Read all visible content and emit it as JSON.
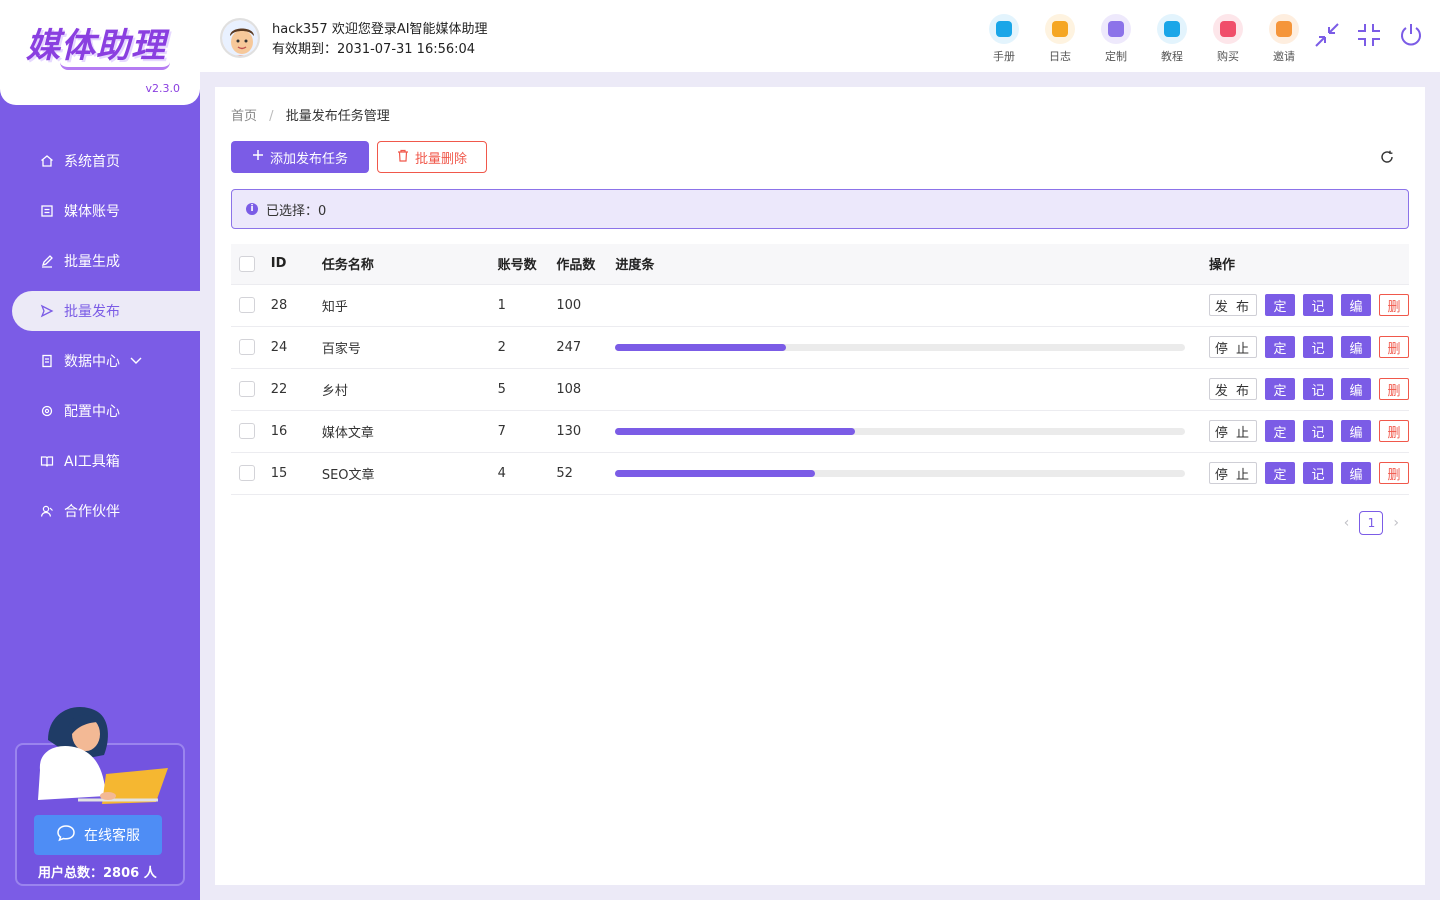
{
  "app": {
    "logo_text": "媒体助理",
    "version": "v2.3.0"
  },
  "sidebar": {
    "items": [
      {
        "label": "系统首页",
        "icon": "home-icon"
      },
      {
        "label": "媒体账号",
        "icon": "account-icon"
      },
      {
        "label": "批量生成",
        "icon": "edit-icon"
      },
      {
        "label": "批量发布",
        "icon": "send-icon",
        "active": true
      },
      {
        "label": "数据中心",
        "icon": "data-icon",
        "has_children": true
      },
      {
        "label": "配置中心",
        "icon": "gear-icon"
      },
      {
        "label": "AI工具箱",
        "icon": "book-icon"
      },
      {
        "label": "合作伙伴",
        "icon": "partner-icon"
      }
    ],
    "service_button": "在线客服",
    "user_total": "用户总数：2806 人"
  },
  "header": {
    "welcome": "hack357 欢迎您登录AI智能媒体助理",
    "expiry": "有效期到：2031-07-31 16:56:04",
    "tools": [
      {
        "label": "手册",
        "icon": "manual-icon",
        "color": "#1aa6e8"
      },
      {
        "label": "日志",
        "icon": "log-icon",
        "color": "#f5a623"
      },
      {
        "label": "定制",
        "icon": "custom-icon",
        "color": "#8c73e9"
      },
      {
        "label": "教程",
        "icon": "tutorial-icon",
        "color": "#1aa6e8"
      },
      {
        "label": "购买",
        "icon": "buy-icon",
        "color": "#f04e6a"
      },
      {
        "label": "邀请",
        "icon": "invite-icon",
        "color": "#f5953a"
      }
    ]
  },
  "breadcrumb": {
    "home": "首页",
    "separator": "/",
    "current": "批量发布任务管理"
  },
  "toolbar": {
    "add_label": "添加发布任务",
    "delete_label": "批量删除"
  },
  "alert": {
    "text": "已选择：0"
  },
  "table": {
    "headers": {
      "id": "ID",
      "name": "任务名称",
      "accounts": "账号数",
      "works": "作品数",
      "progress": "进度条",
      "ops": "操作"
    },
    "rows": [
      {
        "id": "28",
        "name": "知乎",
        "accounts": "1",
        "works": "100",
        "progress": null,
        "action": "发 布"
      },
      {
        "id": "24",
        "name": "百家号",
        "accounts": "2",
        "works": "247",
        "progress": 0.3,
        "action": "停 止"
      },
      {
        "id": "22",
        "name": "乡村",
        "accounts": "5",
        "works": "108",
        "progress": null,
        "action": "发 布"
      },
      {
        "id": "16",
        "name": "媒体文章",
        "accounts": "7",
        "works": "130",
        "progress": 0.42,
        "action": "停 止"
      },
      {
        "id": "15",
        "name": "SEO文章",
        "accounts": "4",
        "works": "52",
        "progress": 0.35,
        "action": "停 止"
      }
    ],
    "row_buttons": {
      "schedule": "定",
      "log": "记",
      "edit": "编",
      "delete": "删"
    }
  },
  "pagination": {
    "current_page": "1",
    "prev": "‹",
    "next": "›"
  },
  "colors": {
    "brand": "#7b5ce6",
    "danger": "#f0584b",
    "service": "#4e8df5"
  }
}
